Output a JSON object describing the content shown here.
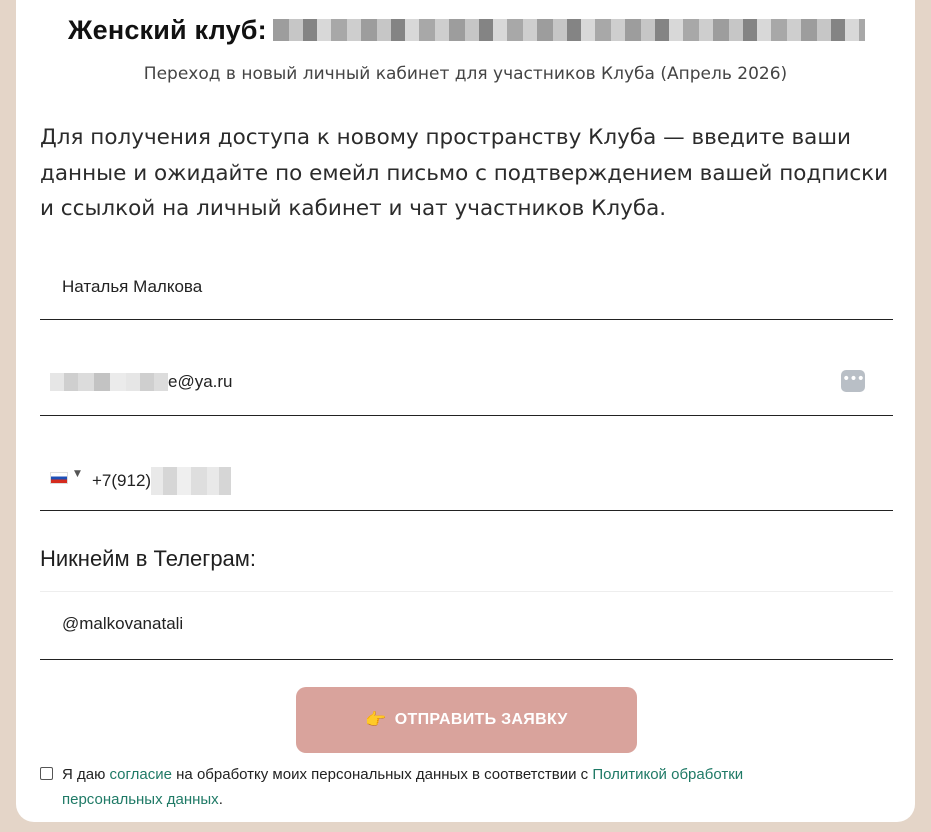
{
  "header": {
    "title": "Женский клуб:",
    "subtitle": "Переход в новый личный кабинет для участников Клуба (Апрель 2026)"
  },
  "intro_text": "Для получения доступа к новому пространству Клуба — введите ваши данные и ожидайте по емейл письмо с подтверждением вашей подписки и ссылкой на личный кабинет и чат участников Клуба.",
  "form": {
    "name_value": "Наталья Малкова",
    "email_value_visible": "e@ya.ru",
    "email_menu_icon": "dots-icon",
    "phone_country": "ru-flag-icon",
    "phone_prefix": "+7(912)",
    "telegram_label": "Никнейм в Телеграм:",
    "telegram_value": "@malkovanatali",
    "submit_icon": "👉",
    "submit_label": "ОТПРАВИТЬ ЗАЯВКУ"
  },
  "consent": {
    "checked": false,
    "text_before": "Я даю ",
    "link1": "согласие",
    "text_middle": " на обработку моих персональных данных в соответствии с ",
    "link2": "Политикой обработки персональных данных",
    "text_after": "."
  },
  "colors": {
    "background": "#e4d5c8",
    "button": "#d9a39c",
    "link": "#1f7a66"
  }
}
